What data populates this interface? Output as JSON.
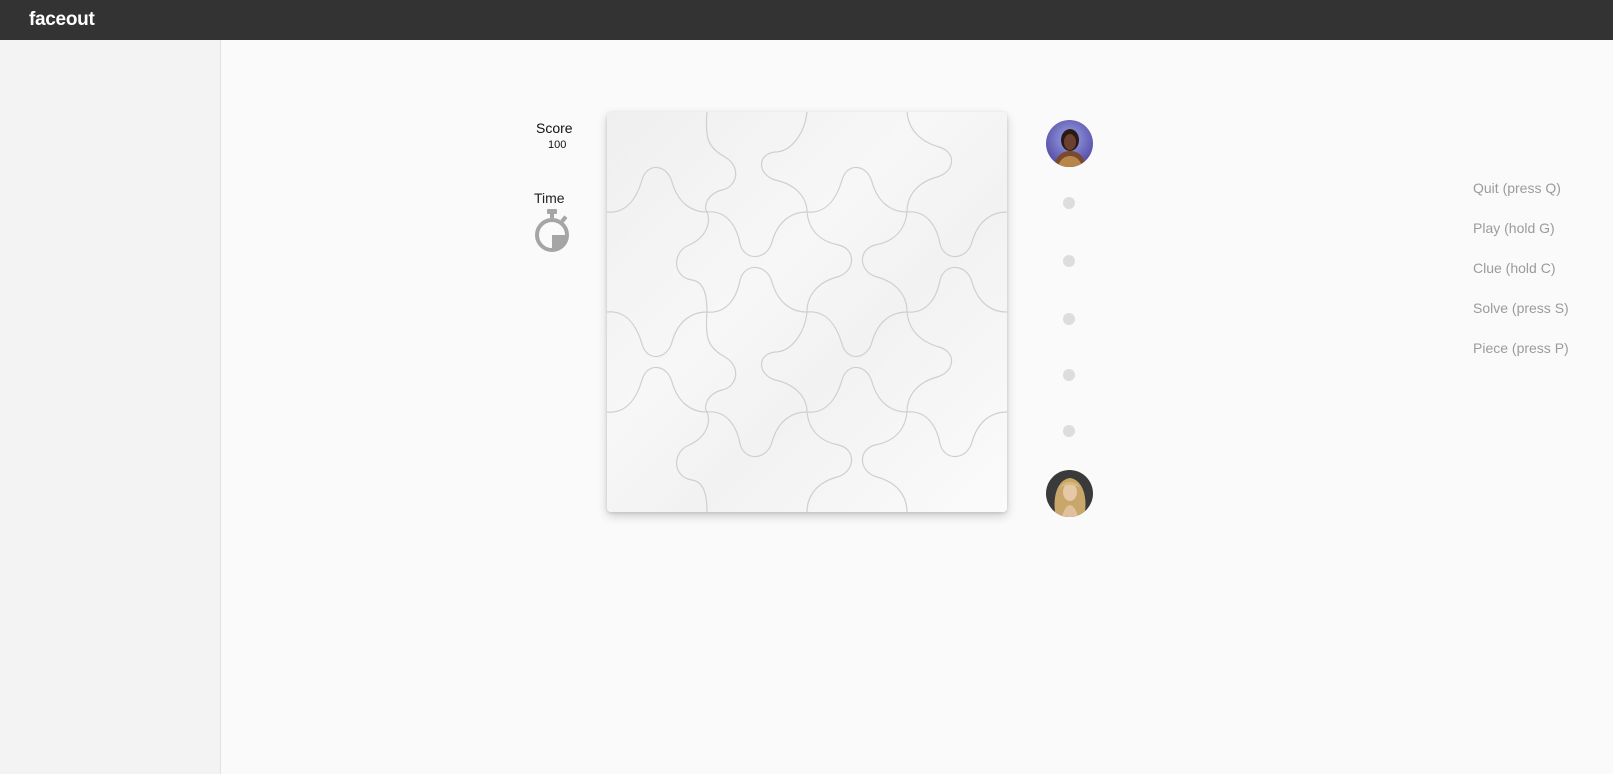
{
  "app": {
    "title": "faceout"
  },
  "score": {
    "label": "Score",
    "value": "100"
  },
  "time": {
    "label": "Time",
    "icon": "stopwatch-icon"
  },
  "progress": {
    "top_avatar": "player-avatar",
    "bottom_avatar": "opponent-avatar",
    "steps": 5
  },
  "controls": [
    {
      "label": "Quit (press Q)"
    },
    {
      "label": "Play (hold G)"
    },
    {
      "label": "Clue (hold C)"
    },
    {
      "label": "Solve (press S)"
    },
    {
      "label": "Piece (press P)"
    }
  ],
  "colors": {
    "topbar": "#333333",
    "sidebar": "#f3f3f3",
    "background": "#fafafa",
    "menu_text": "#9b9b9b",
    "dot": "#dddddd",
    "timer": "#a5a5a5"
  }
}
